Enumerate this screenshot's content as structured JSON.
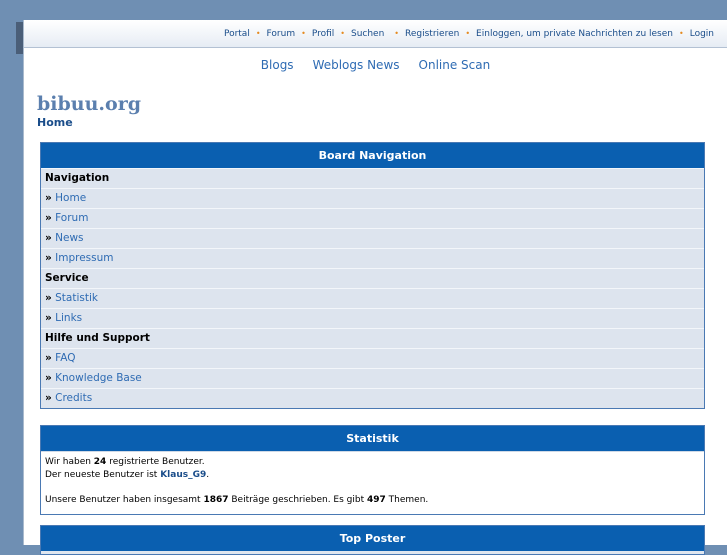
{
  "topnav": {
    "items": [
      "Portal",
      "Forum",
      "Profil",
      "Suchen",
      "Registrieren",
      "Einloggen, um private Nachrichten zu lesen",
      "Login"
    ],
    "separator": "•"
  },
  "subnav": {
    "items": [
      "Blogs",
      "Weblogs News",
      "Online Scan"
    ]
  },
  "site": {
    "title": "bibuu.org",
    "breadcrumb": "Home"
  },
  "board_navigation": {
    "title": "Board Navigation",
    "marker": "»",
    "rows": [
      {
        "type": "category",
        "label": "Navigation"
      },
      {
        "type": "link",
        "label": "Home"
      },
      {
        "type": "link",
        "label": "Forum"
      },
      {
        "type": "link",
        "label": "News"
      },
      {
        "type": "link",
        "label": "Impressum"
      },
      {
        "type": "category",
        "label": "Service"
      },
      {
        "type": "link",
        "label": "Statistik"
      },
      {
        "type": "link",
        "label": "Links"
      },
      {
        "type": "category",
        "label": "Hilfe und Support"
      },
      {
        "type": "link",
        "label": "FAQ"
      },
      {
        "type": "link",
        "label": "Knowledge Base"
      },
      {
        "type": "link",
        "label": "Credits"
      }
    ]
  },
  "statistik": {
    "title": "Statistik",
    "line1_pre": "Wir haben ",
    "user_count": "24",
    "line1_post": " registrierte Benutzer.",
    "line2_pre": "Der neueste Benutzer ist ",
    "newest_user": "Klaus_G9",
    "line2_post": ".",
    "line3_pre": "Unsere Benutzer haben insgesamt ",
    "post_count": "1867",
    "line3_mid": " Beiträge geschrieben. Es gibt ",
    "topic_count": "497",
    "line3_post": " Themen."
  },
  "top_poster": {
    "title": "Top Poster"
  },
  "colors": {
    "header_blue": "#0a5fb0",
    "link": "#2e6bb3",
    "separator": "#e58a1f",
    "background": "#6f8fb3"
  }
}
